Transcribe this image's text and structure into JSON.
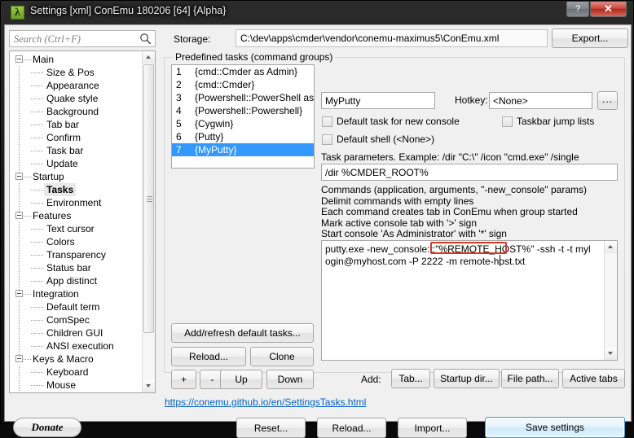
{
  "window": {
    "title": "Settings [xml] ConEmu 180206 [64] {Alpha}",
    "icon": "lambda-icon",
    "icon_glyph": "λ",
    "help_button": "?",
    "close_button": "✕"
  },
  "search": {
    "placeholder": "Search (Ctrl+F)",
    "value": "",
    "icon": "search-icon"
  },
  "storage": {
    "label": "Storage:",
    "path": "C:\\dev\\apps\\cmder\\vendor\\conemu-maximus5\\ConEmu.xml",
    "export_label": "Export..."
  },
  "tree": {
    "selected": "Tasks",
    "nodes": [
      {
        "label": "Main",
        "level": 0,
        "expanded": true
      },
      {
        "label": "Size & Pos",
        "level": 1
      },
      {
        "label": "Appearance",
        "level": 1
      },
      {
        "label": "Quake style",
        "level": 1
      },
      {
        "label": "Background",
        "level": 1
      },
      {
        "label": "Tab bar",
        "level": 1
      },
      {
        "label": "Confirm",
        "level": 1
      },
      {
        "label": "Task bar",
        "level": 1
      },
      {
        "label": "Update",
        "level": 1
      },
      {
        "label": "Startup",
        "level": 0,
        "expanded": true
      },
      {
        "label": "Tasks",
        "level": 1,
        "selected": true
      },
      {
        "label": "Environment",
        "level": 1
      },
      {
        "label": "Features",
        "level": 0,
        "expanded": true
      },
      {
        "label": "Text cursor",
        "level": 1
      },
      {
        "label": "Colors",
        "level": 1
      },
      {
        "label": "Transparency",
        "level": 1
      },
      {
        "label": "Status bar",
        "level": 1
      },
      {
        "label": "App distinct",
        "level": 1
      },
      {
        "label": "Integration",
        "level": 0,
        "expanded": true
      },
      {
        "label": "Default term",
        "level": 1
      },
      {
        "label": "ComSpec",
        "level": 1
      },
      {
        "label": "Children GUI",
        "level": 1
      },
      {
        "label": "ANSI execution",
        "level": 1
      },
      {
        "label": "Keys & Macro",
        "level": 0,
        "expanded": true
      },
      {
        "label": "Keyboard",
        "level": 1
      },
      {
        "label": "Mouse",
        "level": 1
      }
    ]
  },
  "tasks_group": {
    "title": "Predefined tasks (command groups)",
    "items": [
      {
        "num": "1",
        "name": "{cmd::Cmder as Admin}"
      },
      {
        "num": "2",
        "name": "{cmd::Cmder}"
      },
      {
        "num": "3",
        "name": "{Powershell::PowerShell as Ad"
      },
      {
        "num": "4",
        "name": "{Powershell::Powershell}"
      },
      {
        "num": "5",
        "name": "{Cygwin}"
      },
      {
        "num": "6",
        "name": "{Putty}"
      },
      {
        "num": "7",
        "name": "{MyPutty}",
        "selected": true
      }
    ],
    "buttons": {
      "add_refresh": "Add/refresh default tasks...",
      "reload": "Reload...",
      "clone": "Clone",
      "plus": "+",
      "minus": "-",
      "up": "Up",
      "down": "Down"
    }
  },
  "task_detail": {
    "name_value": "MyPutty",
    "hotkey_label": "Hotkey:",
    "hotkey_value": "<None>",
    "hotkey_more_label": "...",
    "checkbox_default_task": "Default task for new console",
    "checkbox_taskbar_jump": "Taskbar jump lists",
    "checkbox_default_shell": "Default shell (<None>)",
    "checkbox_default_task_checked": false,
    "checkbox_taskbar_jump_checked": false,
    "checkbox_default_shell_checked": false,
    "params_hint": "Task parameters. Example: /dir \"C:\\\" /icon \"cmd.exe\" /single",
    "params_value": "/dir %CMDER_ROOT%",
    "command_hints": "Commands (application, arguments, \"-new_console\" params)\nDelimit commands with empty lines\nEach command creates tab in ConEmu when group started\nMark active console tab with '>' sign\nStart console 'As Administrator' with '*' sign",
    "command_text": "putty.exe -new_console:t:\"%REMOTE_HOST%\" -ssh -t -t mylogin@myhost.com -P 2222 -m remote-host.txt",
    "annotation_target": "%REMOTE_HOST%",
    "annotation_color": "#d9342b"
  },
  "add_row": {
    "label": "Add:",
    "tab": "Tab...",
    "startup_dir": "Startup dir...",
    "file_path": "File path...",
    "active_tabs": "Active tabs"
  },
  "help_link": "https://conemu.github.io/en/SettingsTasks.html",
  "footer": {
    "donate": "Donate",
    "reset": "Reset...",
    "reload": "Reload...",
    "import": "Import...",
    "save": "Save settings"
  }
}
